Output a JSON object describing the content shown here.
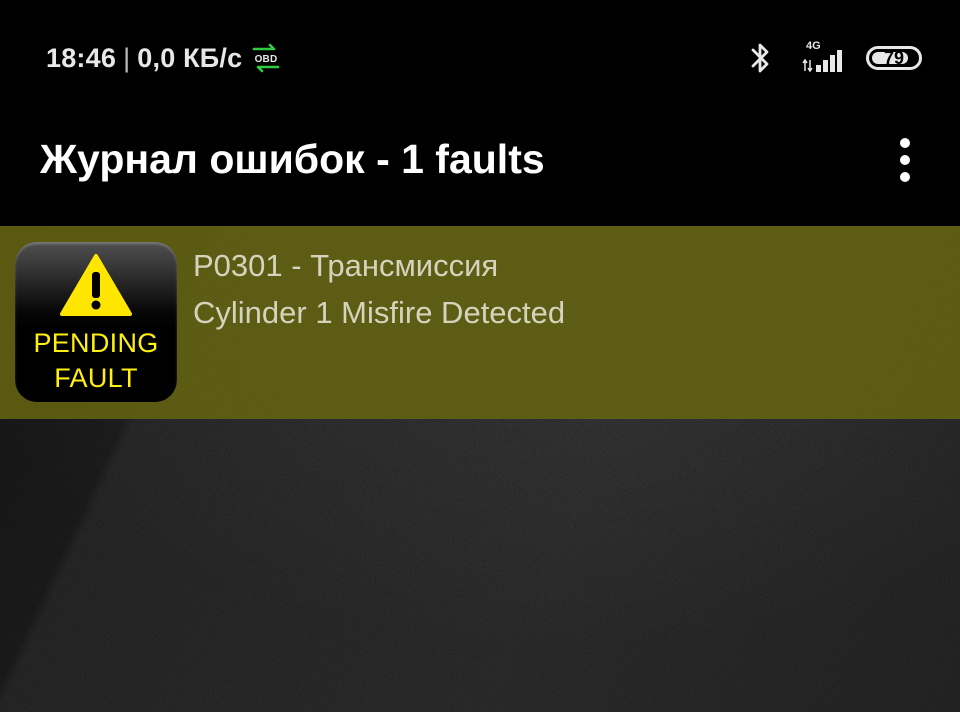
{
  "status_bar": {
    "time": "18:46",
    "separator": "|",
    "speed": "0,0 КБ/с",
    "obd_badge": "OBD",
    "network_type": "4G",
    "battery_level": "79",
    "icons": [
      "obd-connection-icon",
      "bluetooth-icon",
      "cellular-signal-icon",
      "battery-icon"
    ],
    "colors": {
      "obd_accent": "#2ecc40"
    }
  },
  "app_bar": {
    "title": "Журнал ошибок - 1 faults",
    "menu_icon": "more-vert-icon"
  },
  "faults": [
    {
      "badge_line1": "PENDING",
      "badge_line2": "FAULT",
      "code_line": "P0301 - Трансмиссия",
      "description": "Cylinder 1 Misfire Detected",
      "icon": "pending-fault-warning-icon"
    }
  ],
  "colors": {
    "row_highlight": "#646410",
    "badge_text": "#ffef12",
    "background": "#000000"
  }
}
